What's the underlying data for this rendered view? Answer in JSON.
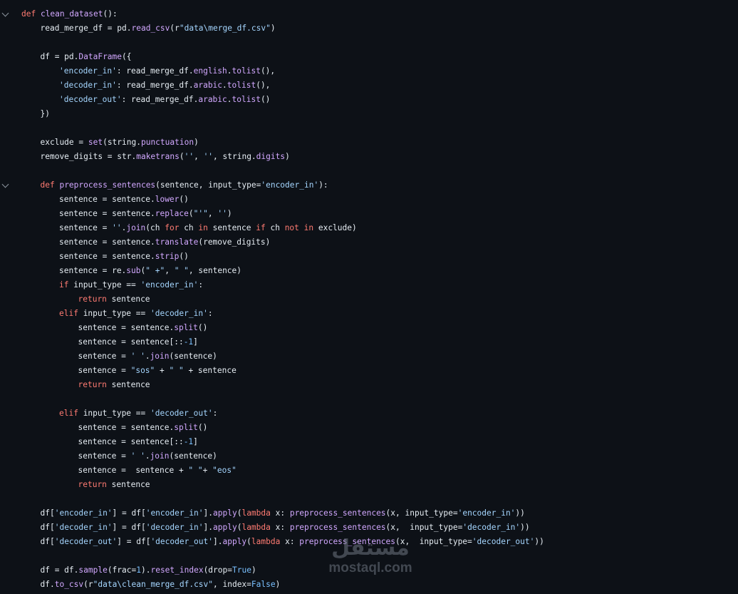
{
  "lines": [
    {
      "fold": true,
      "indent": 0,
      "tokens": [
        [
          "k",
          "def "
        ],
        [
          "f",
          "clean_dataset"
        ],
        [
          "t",
          "():"
        ]
      ]
    },
    {
      "indent": 1,
      "tokens": [
        [
          "t",
          "read_merge_df = pd."
        ],
        [
          "f",
          "read_csv"
        ],
        [
          "t",
          "(r"
        ],
        [
          "s",
          "\"data\\merge_df.csv\""
        ],
        [
          "t",
          ")"
        ]
      ]
    },
    {
      "indent": 0,
      "tokens": []
    },
    {
      "indent": 1,
      "tokens": [
        [
          "t",
          "df = pd."
        ],
        [
          "f",
          "DataFrame"
        ],
        [
          "t",
          "({"
        ]
      ]
    },
    {
      "indent": 2,
      "tokens": [
        [
          "s",
          "'encoder_in'"
        ],
        [
          "t",
          ": read_merge_df."
        ],
        [
          "f",
          "english"
        ],
        [
          "t",
          "."
        ],
        [
          "f",
          "tolist"
        ],
        [
          "t",
          "(),"
        ]
      ]
    },
    {
      "indent": 2,
      "tokens": [
        [
          "s",
          "'decoder_in'"
        ],
        [
          "t",
          ": read_merge_df."
        ],
        [
          "f",
          "arabic"
        ],
        [
          "t",
          "."
        ],
        [
          "f",
          "tolist"
        ],
        [
          "t",
          "(),"
        ]
      ]
    },
    {
      "indent": 2,
      "tokens": [
        [
          "s",
          "'decoder_out'"
        ],
        [
          "t",
          ": read_merge_df."
        ],
        [
          "f",
          "arabic"
        ],
        [
          "t",
          "."
        ],
        [
          "f",
          "tolist"
        ],
        [
          "t",
          "()"
        ]
      ]
    },
    {
      "indent": 1,
      "tokens": [
        [
          "t",
          "})"
        ]
      ]
    },
    {
      "indent": 0,
      "tokens": []
    },
    {
      "indent": 1,
      "tokens": [
        [
          "t",
          "exclude = "
        ],
        [
          "f",
          "set"
        ],
        [
          "t",
          "(string."
        ],
        [
          "f",
          "punctuation"
        ],
        [
          "t",
          ")"
        ]
      ]
    },
    {
      "indent": 1,
      "tokens": [
        [
          "t",
          "remove_digits = str."
        ],
        [
          "f",
          "maketrans"
        ],
        [
          "t",
          "("
        ],
        [
          "s",
          "''"
        ],
        [
          "t",
          ", "
        ],
        [
          "s",
          "''"
        ],
        [
          "t",
          ", string."
        ],
        [
          "f",
          "digits"
        ],
        [
          "t",
          ")"
        ]
      ]
    },
    {
      "indent": 0,
      "tokens": []
    },
    {
      "fold": true,
      "indent": 1,
      "tokens": [
        [
          "k",
          "def "
        ],
        [
          "f",
          "preprocess_sentences"
        ],
        [
          "t",
          "(sentence, input_type="
        ],
        [
          "s",
          "'encoder_in'"
        ],
        [
          "t",
          "):"
        ]
      ]
    },
    {
      "indent": 2,
      "tokens": [
        [
          "t",
          "sentence = sentence."
        ],
        [
          "f",
          "lower"
        ],
        [
          "t",
          "()"
        ]
      ]
    },
    {
      "indent": 2,
      "tokens": [
        [
          "t",
          "sentence = sentence."
        ],
        [
          "f",
          "replace"
        ],
        [
          "t",
          "("
        ],
        [
          "s",
          "\"'\""
        ],
        [
          "t",
          ", "
        ],
        [
          "s",
          "''"
        ],
        [
          "t",
          ")"
        ]
      ]
    },
    {
      "indent": 2,
      "tokens": [
        [
          "t",
          "sentence = "
        ],
        [
          "s",
          "''"
        ],
        [
          "t",
          "."
        ],
        [
          "f",
          "join"
        ],
        [
          "t",
          "(ch "
        ],
        [
          "k",
          "for"
        ],
        [
          "t",
          " ch "
        ],
        [
          "k",
          "in"
        ],
        [
          "t",
          " sentence "
        ],
        [
          "k",
          "if"
        ],
        [
          "t",
          " ch "
        ],
        [
          "k",
          "not in"
        ],
        [
          "t",
          " exclude)"
        ]
      ]
    },
    {
      "indent": 2,
      "tokens": [
        [
          "t",
          "sentence = sentence."
        ],
        [
          "f",
          "translate"
        ],
        [
          "t",
          "(remove_digits)"
        ]
      ]
    },
    {
      "indent": 2,
      "tokens": [
        [
          "t",
          "sentence = sentence."
        ],
        [
          "f",
          "strip"
        ],
        [
          "t",
          "()"
        ]
      ]
    },
    {
      "indent": 2,
      "tokens": [
        [
          "t",
          "sentence = re."
        ],
        [
          "f",
          "sub"
        ],
        [
          "t",
          "("
        ],
        [
          "s",
          "\" +\""
        ],
        [
          "t",
          ", "
        ],
        [
          "s",
          "\" \""
        ],
        [
          "t",
          ", sentence)"
        ]
      ]
    },
    {
      "indent": 2,
      "tokens": [
        [
          "k",
          "if"
        ],
        [
          "t",
          " input_type == "
        ],
        [
          "s",
          "'encoder_in'"
        ],
        [
          "t",
          ":"
        ]
      ]
    },
    {
      "indent": 3,
      "tokens": [
        [
          "k",
          "return"
        ],
        [
          "t",
          " sentence"
        ]
      ]
    },
    {
      "indent": 2,
      "tokens": [
        [
          "k",
          "elif"
        ],
        [
          "t",
          " input_type == "
        ],
        [
          "s",
          "'decoder_in'"
        ],
        [
          "t",
          ":"
        ]
      ]
    },
    {
      "indent": 3,
      "tokens": [
        [
          "t",
          "sentence = sentence."
        ],
        [
          "f",
          "split"
        ],
        [
          "t",
          "()"
        ]
      ]
    },
    {
      "indent": 3,
      "tokens": [
        [
          "t",
          "sentence = sentence[::"
        ],
        [
          "n",
          "-1"
        ],
        [
          "t",
          "]"
        ]
      ]
    },
    {
      "indent": 3,
      "tokens": [
        [
          "t",
          "sentence = "
        ],
        [
          "s",
          "' '"
        ],
        [
          "t",
          "."
        ],
        [
          "f",
          "join"
        ],
        [
          "t",
          "(sentence)"
        ]
      ]
    },
    {
      "indent": 3,
      "tokens": [
        [
          "t",
          "sentence = "
        ],
        [
          "s",
          "\"sos\""
        ],
        [
          "t",
          " + "
        ],
        [
          "s",
          "\" \""
        ],
        [
          "t",
          " + sentence"
        ]
      ]
    },
    {
      "indent": 3,
      "tokens": [
        [
          "k",
          "return"
        ],
        [
          "t",
          " sentence"
        ]
      ]
    },
    {
      "indent": 0,
      "tokens": []
    },
    {
      "indent": 2,
      "tokens": [
        [
          "k",
          "elif"
        ],
        [
          "t",
          " input_type == "
        ],
        [
          "s",
          "'decoder_out'"
        ],
        [
          "t",
          ":"
        ]
      ]
    },
    {
      "indent": 3,
      "tokens": [
        [
          "t",
          "sentence = sentence."
        ],
        [
          "f",
          "split"
        ],
        [
          "t",
          "()"
        ]
      ]
    },
    {
      "indent": 3,
      "tokens": [
        [
          "t",
          "sentence = sentence[::"
        ],
        [
          "n",
          "-1"
        ],
        [
          "t",
          "]"
        ]
      ]
    },
    {
      "indent": 3,
      "tokens": [
        [
          "t",
          "sentence = "
        ],
        [
          "s",
          "' '"
        ],
        [
          "t",
          "."
        ],
        [
          "f",
          "join"
        ],
        [
          "t",
          "(sentence)"
        ]
      ]
    },
    {
      "indent": 3,
      "tokens": [
        [
          "t",
          "sentence =  sentence + "
        ],
        [
          "s",
          "\" \""
        ],
        [
          "t",
          "+ "
        ],
        [
          "s",
          "\"eos\""
        ]
      ]
    },
    {
      "indent": 3,
      "tokens": [
        [
          "k",
          "return"
        ],
        [
          "t",
          " sentence"
        ]
      ]
    },
    {
      "indent": 0,
      "tokens": []
    },
    {
      "indent": 1,
      "tokens": [
        [
          "t",
          "df["
        ],
        [
          "s",
          "'encoder_in'"
        ],
        [
          "t",
          "] = df["
        ],
        [
          "s",
          "'encoder_in'"
        ],
        [
          "t",
          "]."
        ],
        [
          "f",
          "apply"
        ],
        [
          "t",
          "("
        ],
        [
          "k",
          "lambda"
        ],
        [
          "t",
          " x: "
        ],
        [
          "f",
          "preprocess_sentences"
        ],
        [
          "t",
          "(x, input_type="
        ],
        [
          "s",
          "'encoder_in'"
        ],
        [
          "t",
          "))"
        ]
      ]
    },
    {
      "indent": 1,
      "tokens": [
        [
          "t",
          "df["
        ],
        [
          "s",
          "'decoder_in'"
        ],
        [
          "t",
          "] = df["
        ],
        [
          "s",
          "'decoder_in'"
        ],
        [
          "t",
          "]."
        ],
        [
          "f",
          "apply"
        ],
        [
          "t",
          "("
        ],
        [
          "k",
          "lambda"
        ],
        [
          "t",
          " x: "
        ],
        [
          "f",
          "preprocess_sentences"
        ],
        [
          "t",
          "(x,  input_type="
        ],
        [
          "s",
          "'decoder_in'"
        ],
        [
          "t",
          "))"
        ]
      ]
    },
    {
      "indent": 1,
      "tokens": [
        [
          "t",
          "df["
        ],
        [
          "s",
          "'decoder_out'"
        ],
        [
          "t",
          "] = df["
        ],
        [
          "s",
          "'decoder_out'"
        ],
        [
          "t",
          "]."
        ],
        [
          "f",
          "apply"
        ],
        [
          "t",
          "("
        ],
        [
          "k",
          "lambda"
        ],
        [
          "t",
          " x: "
        ],
        [
          "f",
          "preprocess_sentences"
        ],
        [
          "t",
          "(x,  input_type="
        ],
        [
          "s",
          "'decoder_out'"
        ],
        [
          "t",
          "))"
        ]
      ]
    },
    {
      "indent": 0,
      "tokens": []
    },
    {
      "indent": 1,
      "tokens": [
        [
          "t",
          "df = df."
        ],
        [
          "f",
          "sample"
        ],
        [
          "t",
          "(frac="
        ],
        [
          "n",
          "1"
        ],
        [
          "t",
          ")."
        ],
        [
          "f",
          "reset_index"
        ],
        [
          "t",
          "(drop="
        ],
        [
          "n",
          "True"
        ],
        [
          "t",
          ")"
        ]
      ]
    },
    {
      "indent": 1,
      "tokens": [
        [
          "t",
          "df."
        ],
        [
          "f",
          "to_csv"
        ],
        [
          "t",
          "(r"
        ],
        [
          "s",
          "\"data\\clean_merge_df.csv\""
        ],
        [
          "t",
          ", index="
        ],
        [
          "n",
          "False"
        ],
        [
          "t",
          ")"
        ]
      ]
    }
  ],
  "watermark": {
    "arabic": "مستقل",
    "latin": "mostaql.com"
  },
  "colors": {
    "background": "#0d1117",
    "keyword": "#ff7b72",
    "function": "#d2a8ff",
    "string": "#a5d6ff",
    "number": "#79c0ff",
    "text": "#e6edf3"
  }
}
